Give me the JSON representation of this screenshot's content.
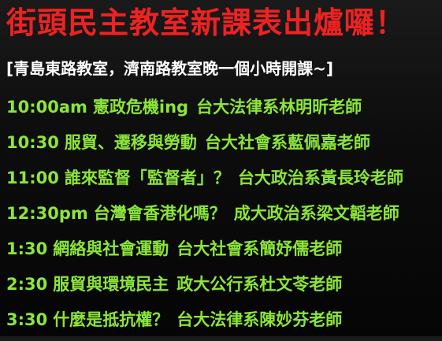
{
  "title": "街頭民主教室新課表出爐囉！",
  "subtitle": "[青島東路教室，濟南路教室晚一個小時開課~]",
  "sessions": [
    {
      "time": "10:00am",
      "topic": "憲政危機ing",
      "speaker": "台大法律系林明昕老師"
    },
    {
      "time": "10:30",
      "topic": "服貿、遷移與勞動",
      "speaker": "台大社會系藍佩嘉老師"
    },
    {
      "time": "11:00",
      "topic": "誰來監督「監督者」？",
      "speaker": "台大政治系黃長玲老師"
    },
    {
      "time": "12:30pm",
      "topic": "台灣會香港化嗎？",
      "speaker": "成大政治系梁文韜老師"
    },
    {
      "time": "1:30",
      "topic": "網絡與社會運動",
      "speaker": "台大社會系簡妤儒老師"
    },
    {
      "time": "2:30",
      "topic": "服貿與環境民主",
      "speaker": "政大公行系杜文苓老師"
    },
    {
      "time": "3:30",
      "topic": "什麼是抵抗權？",
      "speaker": "台大法律系陳妙芬老師"
    }
  ],
  "colors": {
    "title": "#ee2222",
    "subtitle": "#ffffff",
    "schedule": "#8ce639",
    "background": "#0d0d0d"
  }
}
